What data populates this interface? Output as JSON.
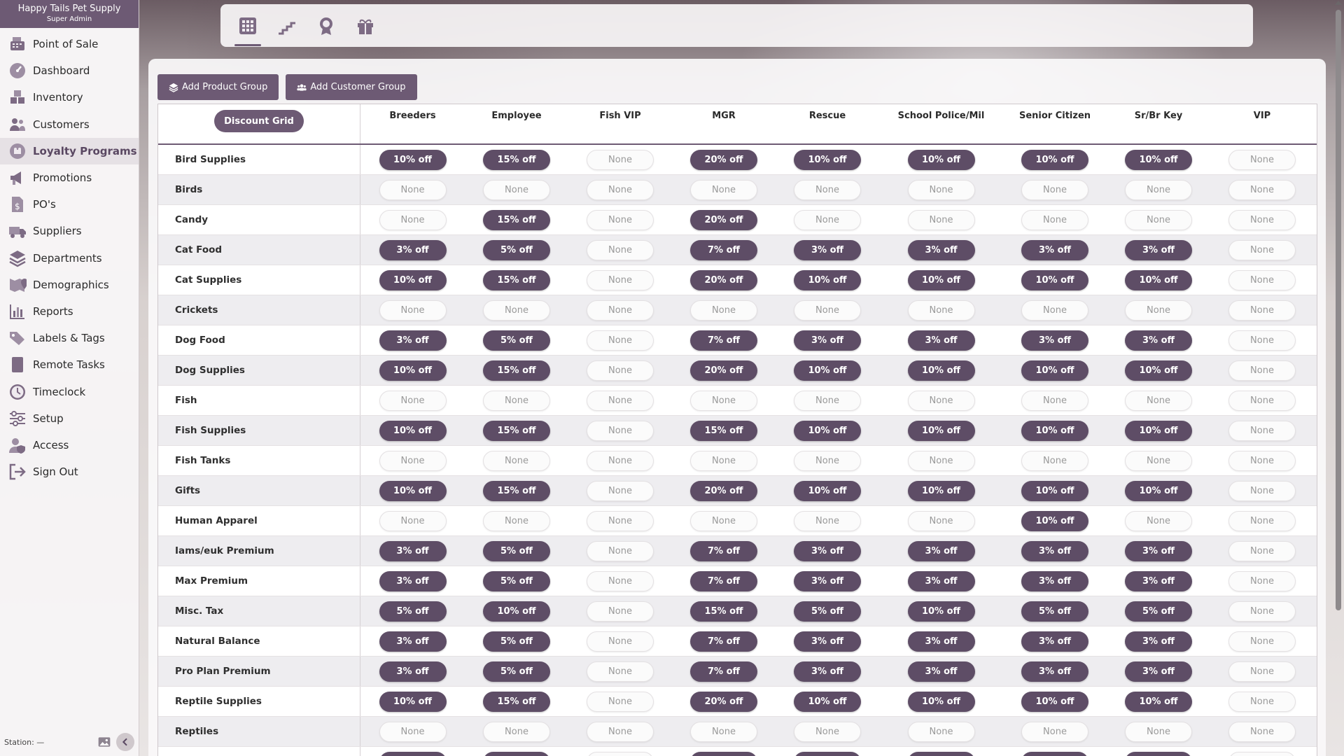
{
  "brand": {
    "name": "Happy Tails Pet Supply",
    "role": "Super Admin"
  },
  "nav": [
    {
      "label": "Point of Sale",
      "icon": "register-icon",
      "active": false
    },
    {
      "label": "Dashboard",
      "icon": "gauge-icon",
      "active": false
    },
    {
      "label": "Inventory",
      "icon": "boxes-icon",
      "active": false
    },
    {
      "label": "Customers",
      "icon": "people-icon",
      "active": false
    },
    {
      "label": "Loyalty Programs",
      "icon": "loyalty-icon",
      "active": true
    },
    {
      "label": "Promotions",
      "icon": "megaphone-icon",
      "active": false
    },
    {
      "label": "PO's",
      "icon": "document-dollar-icon",
      "active": false
    },
    {
      "label": "Suppliers",
      "icon": "truck-icon",
      "active": false
    },
    {
      "label": "Departments",
      "icon": "layers-icon",
      "active": false
    },
    {
      "label": "Demographics",
      "icon": "map-pin-icon",
      "active": false
    },
    {
      "label": "Reports",
      "icon": "chart-icon",
      "active": false
    },
    {
      "label": "Labels & Tags",
      "icon": "tags-icon",
      "active": false
    },
    {
      "label": "Remote Tasks",
      "icon": "tablet-icon",
      "active": false
    },
    {
      "label": "Timeclock",
      "icon": "clock-icon",
      "active": false
    },
    {
      "label": "Setup",
      "icon": "sliders-icon",
      "active": false
    },
    {
      "label": "Access",
      "icon": "user-shield-icon",
      "active": false
    },
    {
      "label": "Sign Out",
      "icon": "sign-out-icon",
      "active": false
    }
  ],
  "footer": {
    "station": "Station: —"
  },
  "toolbar": [
    "grid-icon",
    "stairs-icon",
    "award-icon",
    "gift-icon"
  ],
  "actions": {
    "add_product_group": "Add Product Group",
    "add_customer_group": "Add Customer Group"
  },
  "grid": {
    "corner_label": "Discount Grid",
    "columns": [
      "Breeders",
      "Employee",
      "Fish VIP",
      "MGR",
      "Rescue",
      "School Police/Mil",
      "Senior Citizen",
      "Sr/Br Key",
      "VIP"
    ],
    "rows": [
      {
        "label": "Bird Supplies",
        "values": [
          "10% off",
          "15% off",
          "None",
          "20% off",
          "10% off",
          "10% off",
          "10% off",
          "10% off",
          "None"
        ]
      },
      {
        "label": "Birds",
        "values": [
          "None",
          "None",
          "None",
          "None",
          "None",
          "None",
          "None",
          "None",
          "None"
        ]
      },
      {
        "label": "Candy",
        "values": [
          "None",
          "15% off",
          "None",
          "20% off",
          "None",
          "None",
          "None",
          "None",
          "None"
        ]
      },
      {
        "label": "Cat Food",
        "values": [
          "3% off",
          "5% off",
          "None",
          "7% off",
          "3% off",
          "3% off",
          "3% off",
          "3% off",
          "None"
        ]
      },
      {
        "label": "Cat Supplies",
        "values": [
          "10% off",
          "15% off",
          "None",
          "20% off",
          "10% off",
          "10% off",
          "10% off",
          "10% off",
          "None"
        ]
      },
      {
        "label": "Crickets",
        "values": [
          "None",
          "None",
          "None",
          "None",
          "None",
          "None",
          "None",
          "None",
          "None"
        ]
      },
      {
        "label": "Dog Food",
        "values": [
          "3% off",
          "5% off",
          "None",
          "7% off",
          "3% off",
          "3% off",
          "3% off",
          "3% off",
          "None"
        ]
      },
      {
        "label": "Dog Supplies",
        "values": [
          "10% off",
          "15% off",
          "None",
          "20% off",
          "10% off",
          "10% off",
          "10% off",
          "10% off",
          "None"
        ]
      },
      {
        "label": "Fish",
        "values": [
          "None",
          "None",
          "None",
          "None",
          "None",
          "None",
          "None",
          "None",
          "None"
        ]
      },
      {
        "label": "Fish Supplies",
        "values": [
          "10% off",
          "15% off",
          "None",
          "15% off",
          "10% off",
          "10% off",
          "10% off",
          "10% off",
          "None"
        ]
      },
      {
        "label": "Fish Tanks",
        "values": [
          "None",
          "None",
          "None",
          "None",
          "None",
          "None",
          "None",
          "None",
          "None"
        ]
      },
      {
        "label": "Gifts",
        "values": [
          "10% off",
          "15% off",
          "None",
          "20% off",
          "10% off",
          "10% off",
          "10% off",
          "10% off",
          "None"
        ]
      },
      {
        "label": "Human Apparel",
        "values": [
          "None",
          "None",
          "None",
          "None",
          "None",
          "None",
          "10% off",
          "None",
          "None"
        ]
      },
      {
        "label": "Iams/euk Premium",
        "values": [
          "3% off",
          "5% off",
          "None",
          "7% off",
          "3% off",
          "3% off",
          "3% off",
          "3% off",
          "None"
        ]
      },
      {
        "label": "Max Premium",
        "values": [
          "3% off",
          "5% off",
          "None",
          "7% off",
          "3% off",
          "3% off",
          "3% off",
          "3% off",
          "None"
        ]
      },
      {
        "label": "Misc. Tax",
        "values": [
          "5% off",
          "10% off",
          "None",
          "15% off",
          "5% off",
          "10% off",
          "5% off",
          "5% off",
          "None"
        ]
      },
      {
        "label": "Natural Balance",
        "values": [
          "3% off",
          "5% off",
          "None",
          "7% off",
          "3% off",
          "3% off",
          "3% off",
          "3% off",
          "None"
        ]
      },
      {
        "label": "Pro Plan Premium",
        "values": [
          "3% off",
          "5% off",
          "None",
          "7% off",
          "3% off",
          "3% off",
          "3% off",
          "3% off",
          "None"
        ]
      },
      {
        "label": "Reptile Supplies",
        "values": [
          "10% off",
          "15% off",
          "None",
          "20% off",
          "10% off",
          "10% off",
          "10% off",
          "10% off",
          "None"
        ]
      },
      {
        "label": "Reptiles",
        "values": [
          "None",
          "None",
          "None",
          "None",
          "None",
          "None",
          "None",
          "None",
          "None"
        ]
      },
      {
        "label": "",
        "values": [
          "",
          "",
          "",
          "",
          "",
          "",
          "",
          "",
          ""
        ]
      }
    ]
  }
}
